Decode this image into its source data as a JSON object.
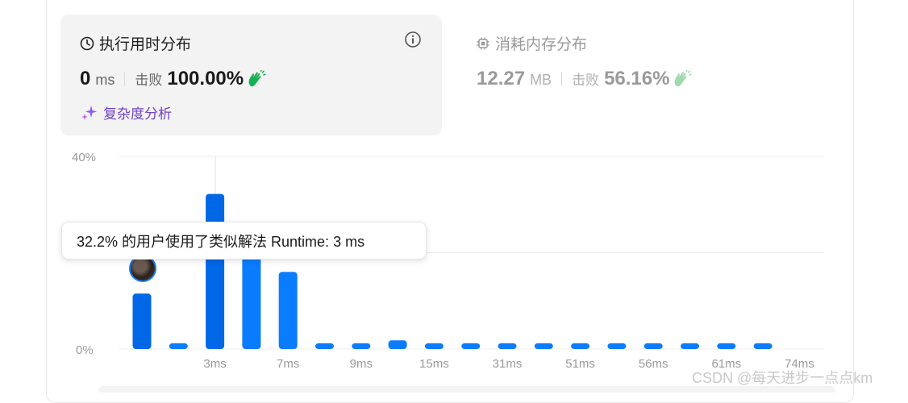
{
  "runtime_panel": {
    "title": "执行用时分布",
    "value": "0",
    "unit": "ms",
    "beats_label": "击败",
    "beats_value": "100.00%",
    "complexity_link": "复杂度分析"
  },
  "memory_panel": {
    "title": "消耗内存分布",
    "value": "12.27",
    "unit": "MB",
    "beats_label": "击败",
    "beats_value": "56.16%"
  },
  "tooltip": {
    "text": "32.2% 的用户使用了类似解法 Runtime: 3 ms"
  },
  "watermark": "CSDN @每天进步一点点km",
  "colors": {
    "bar": "#0a7cff",
    "bar_active": "#0067e6",
    "clap_green": "#17b054",
    "purple": "#6f42c1"
  },
  "icons": {
    "runtime": "clock-icon",
    "memory": "chip-icon",
    "info": "info-circle-icon",
    "beats": "clapping-hands-icon",
    "complexity": "sparkle-icon"
  },
  "chart_data": {
    "type": "bar",
    "y_ticks": [
      "40%",
      "0%"
    ],
    "ylim": [
      0,
      40
    ],
    "x_tick_labels": [
      "3ms",
      "7ms",
      "9ms",
      "15ms",
      "31ms",
      "51ms",
      "56ms",
      "61ms",
      "74ms"
    ],
    "values": [
      11.5,
      1.2,
      32.2,
      22,
      16,
      1.2,
      1.2,
      1.8,
      1.2,
      1.2,
      1.2,
      1.2,
      1.2,
      1.2,
      1.2,
      1.2,
      1.2,
      1.2
    ],
    "x_tick_positions": [
      2,
      4,
      6,
      8,
      10,
      12,
      14,
      16,
      18
    ],
    "selected_index": 2,
    "user_index": 0,
    "grid": true
  }
}
